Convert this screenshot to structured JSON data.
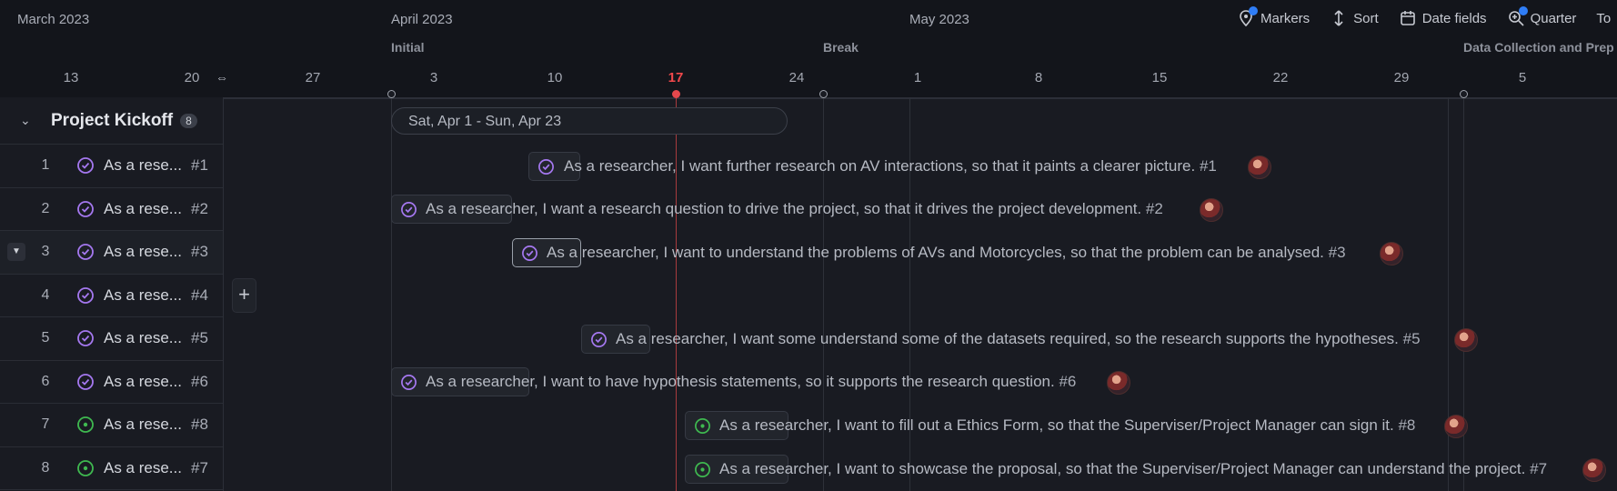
{
  "timeline": {
    "months": [
      "March 2023",
      "April 2023",
      "May 2023"
    ],
    "iterations": [
      "Initial",
      "Break",
      "Data Collection and Prep"
    ],
    "ticks": [
      "13",
      "20",
      "27",
      "3",
      "10",
      "17",
      "24",
      "1",
      "8",
      "15",
      "22",
      "29",
      "5"
    ],
    "today_tick": "17",
    "date_range": "Sat, Apr 1 - Sun, Apr 23"
  },
  "toolbar": {
    "markers": "Markers",
    "sort": "Sort",
    "date_fields": "Date fields",
    "zoom": "Quarter",
    "today": "To"
  },
  "group": {
    "title": "Project Kickoff",
    "count": "8"
  },
  "rows": [
    {
      "num": "1",
      "title": "As a rese...",
      "id": "#1",
      "status": "done"
    },
    {
      "num": "2",
      "title": "As a rese...",
      "id": "#2",
      "status": "done"
    },
    {
      "num": "3",
      "title": "As a rese...",
      "id": "#3",
      "status": "done"
    },
    {
      "num": "4",
      "title": "As a rese...",
      "id": "#4",
      "status": "done"
    },
    {
      "num": "5",
      "title": "As a rese...",
      "id": "#5",
      "status": "done"
    },
    {
      "num": "6",
      "title": "As a rese...",
      "id": "#6",
      "status": "done"
    },
    {
      "num": "7",
      "title": "As a rese...",
      "id": "#8",
      "status": "open"
    },
    {
      "num": "8",
      "title": "As a rese...",
      "id": "#7",
      "status": "open"
    }
  ],
  "bars": [
    {
      "title": "As a researcher, I want further research on AV interactions, so that it paints a clearer picture.",
      "num": "#1"
    },
    {
      "title": "As a researcher, I want a research question to drive the project, so that it drives the project development.",
      "num": "#2"
    },
    {
      "title": "As a researcher, I want to understand the problems of AVs and Motorcycles, so that the problem can be analysed.",
      "num": "#3"
    },
    {
      "title": "As a researcher, I want some understand some of the datasets required, so the research supports the hypotheses.",
      "num": "#5"
    },
    {
      "title": "As a researcher, I want to have hypothesis statements, so it supports the research question.",
      "num": "#6"
    },
    {
      "title": "As a researcher, I want to fill out a Ethics Form, so that the Superviser/Project Manager can sign it.",
      "num": "#8"
    },
    {
      "title": "As a researcher, I want to showcase the proposal, so that the Superviser/Project Manager can understand the project.",
      "num": "#7"
    }
  ],
  "colors": {
    "done": "#a578f0",
    "open": "#3fb950",
    "today": "#e5484d",
    "link": "#5a9ef0"
  }
}
